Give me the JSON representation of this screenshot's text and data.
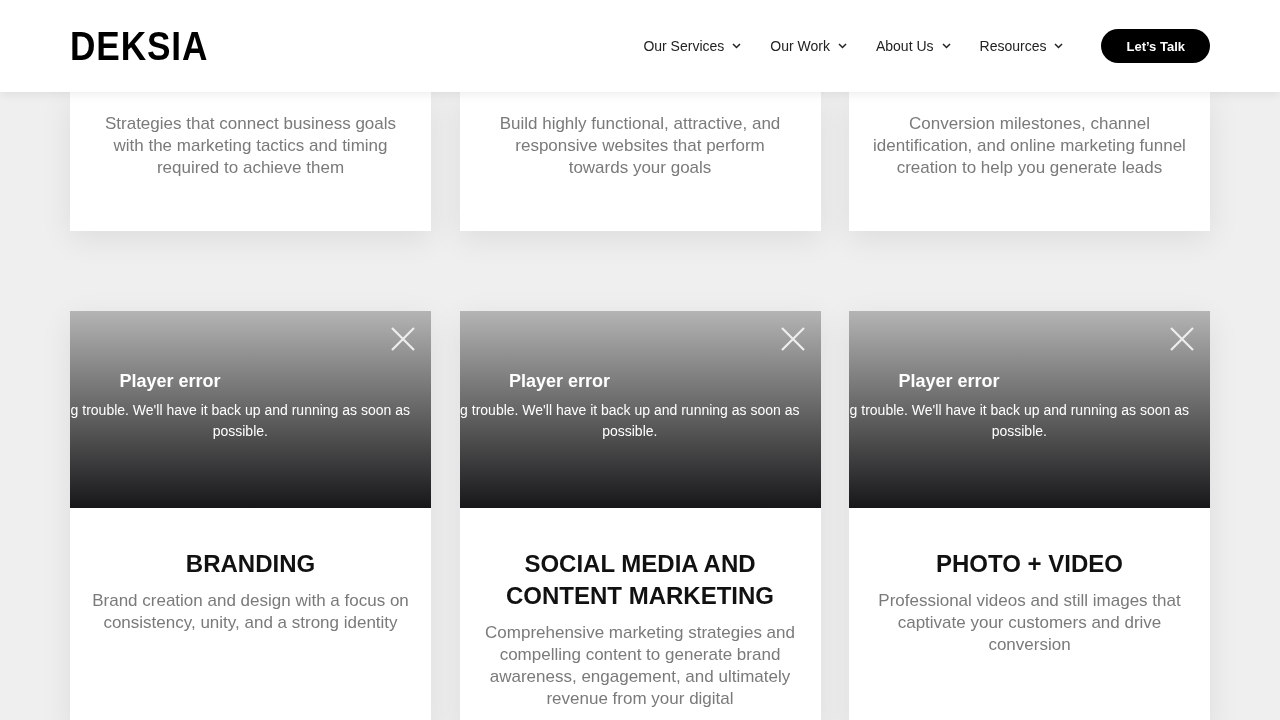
{
  "header": {
    "logo": "DEKSIA",
    "nav": [
      {
        "label": "Our Services"
      },
      {
        "label": "Our Work"
      },
      {
        "label": "About Us"
      },
      {
        "label": "Resources"
      }
    ],
    "cta": "Let’s Talk"
  },
  "top_cards": [
    {
      "description": "Strategies that connect business goals with the marketing tactics and timing required to achieve them"
    },
    {
      "description": "Build highly functional, attractive, and responsive websites that perform towards your goals"
    },
    {
      "description": "Conversion milestones, channel identification, and online marketing funnel creation to help you generate leads"
    }
  ],
  "service_cards": [
    {
      "player": {
        "title": "Player error",
        "message": "g trouble. We'll have it back up and running as soon as\npossible."
      },
      "title": "BRANDING",
      "description": "Brand creation and design with a focus on consistency, unity, and a strong identity"
    },
    {
      "player": {
        "title": "Player error",
        "message": "g trouble. We'll have it back up and running as soon as\npossible."
      },
      "title": "SOCIAL MEDIA AND CONTENT MARKETING",
      "description": "Comprehensive marketing strategies and compelling content to generate brand awareness, engagement, and ultimately revenue from your digital"
    },
    {
      "player": {
        "title": "Player error",
        "message": "g trouble. We'll have it back up and running as soon as\npossible."
      },
      "title": "PHOTO + VIDEO",
      "description": "Professional videos and still images that captivate your customers and drive conversion"
    }
  ]
}
